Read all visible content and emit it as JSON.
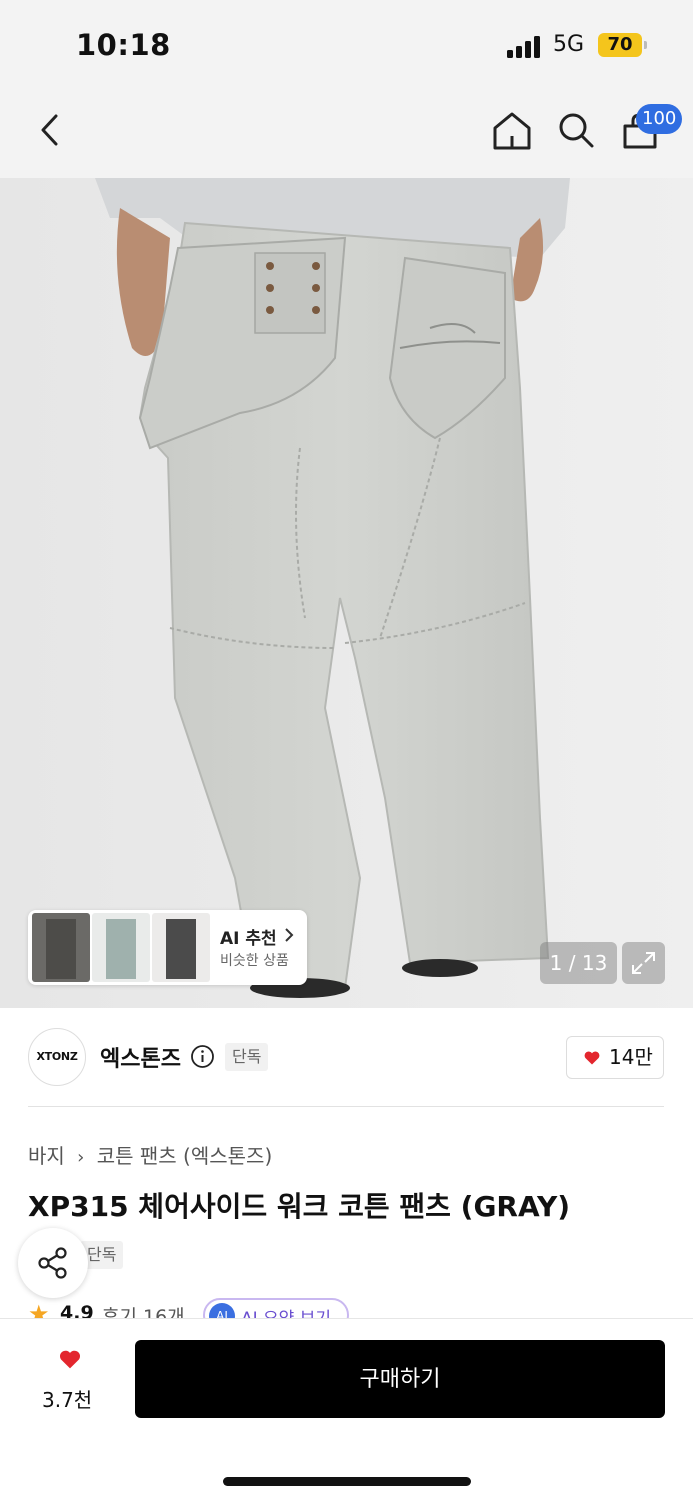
{
  "status_bar": {
    "time": "10:18",
    "network": "5G",
    "battery": "70"
  },
  "nav": {
    "cart_badge": "100",
    "icons": [
      "back-icon",
      "home-icon",
      "search-icon",
      "shopping-bag-icon"
    ]
  },
  "gallery": {
    "counter": "1 / 13",
    "ai_recommend": {
      "title": "AI 추천",
      "subtitle": "비슷한 상품"
    }
  },
  "brand": {
    "logo_text": "XTONZ",
    "name": "엑스톤즈",
    "exclusive_tag": "단독",
    "likes": "14만"
  },
  "product": {
    "breadcrumb": [
      "바지",
      "코튼 팬츠 (엑스톤즈)"
    ],
    "title": "XP315 체어사이드 워크 코튼 팬츠 (GRAY)",
    "exclusive_tag": "단독",
    "rating": "4.9",
    "reviews": "후기 16개",
    "ai_summary": "AI 요약 보기"
  },
  "bottom": {
    "wish_count": "3.7천",
    "buy_label": "구매하기"
  },
  "colors": {
    "accent_blue": "#2f6de1",
    "heart_red": "#e3262e",
    "battery_yellow": "#f4c51c",
    "star_orange": "#f5a623"
  }
}
